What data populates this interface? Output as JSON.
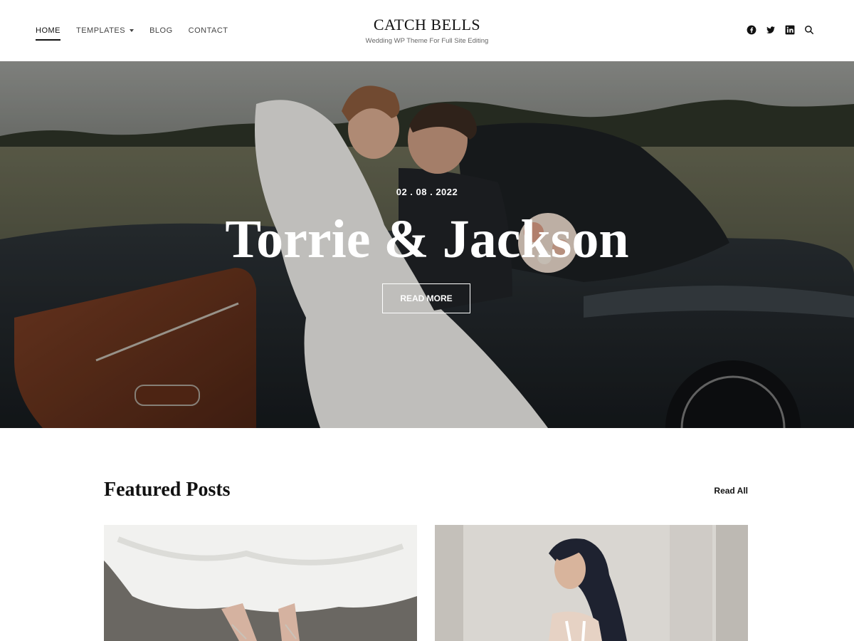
{
  "nav": {
    "items": [
      {
        "label": "HOME",
        "active": true
      },
      {
        "label": "TEMPLATES",
        "has_dropdown": true
      },
      {
        "label": "BLOG"
      },
      {
        "label": "CONTACT"
      }
    ]
  },
  "brand": {
    "title": "CATCH BELLS",
    "subtitle": "Wedding WP Theme For Full Site Editing"
  },
  "social": {
    "icons": [
      "facebook-icon",
      "twitter-icon",
      "linkedin-icon",
      "search-icon"
    ]
  },
  "hero": {
    "date": "02 . 08 . 2022",
    "title": "Torrie & Jackson",
    "button_label": "READ MORE"
  },
  "featured": {
    "title": "Featured Posts",
    "read_all_label": "Read All"
  },
  "colors": {
    "text": "#111111",
    "muted": "#666666",
    "hero_overlay": "rgba(0,0,0,0.18)"
  }
}
